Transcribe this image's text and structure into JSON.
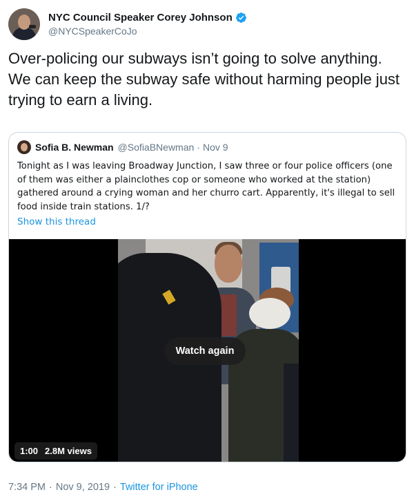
{
  "author": {
    "display_name": "NYC Council Speaker Corey Johnson",
    "handle": "@NYCSpeakerCoJo",
    "verified_icon": "verified-badge-icon"
  },
  "tweet": {
    "text": "Over-policing our subways isn’t going to solve anything. We can keep the subway safe without harming people just trying to earn a living."
  },
  "quoted_tweet": {
    "display_name": "Sofia B. Newman",
    "handle": "@SofiaBNewman",
    "date": "Nov 9",
    "text": "Tonight as I was leaving Broadway Junction, I saw three or four police officers (one of them was either a plainclothes cop or someone who worked at the station) gathered around a crying woman and her churro cart. Apparently, it's illegal to sell food inside train stations. 1/?",
    "thread_link": "Show this thread",
    "video": {
      "overlay_label": "Watch again",
      "duration": "1:00",
      "views": "2.8M views"
    }
  },
  "footer": {
    "time": "7:34 PM",
    "date": "Nov 9, 2019",
    "source": "Twitter for iPhone"
  },
  "colors": {
    "link": "#1b95e0",
    "secondary_text": "#657786",
    "verified": "#1da1f2"
  }
}
